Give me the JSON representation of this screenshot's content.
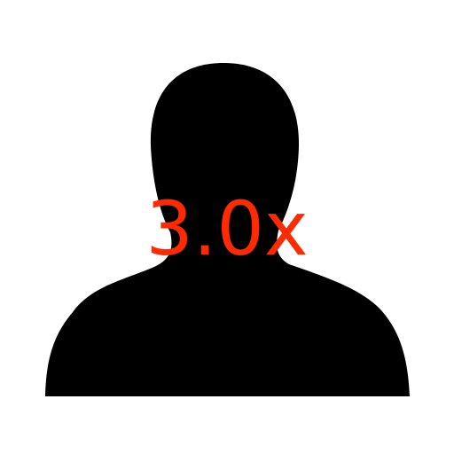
{
  "icon": {
    "name": "person-silhouette-icon",
    "fill": "#000000"
  },
  "badge": {
    "scale_text": "3.0x",
    "color": "#ff2a00"
  }
}
